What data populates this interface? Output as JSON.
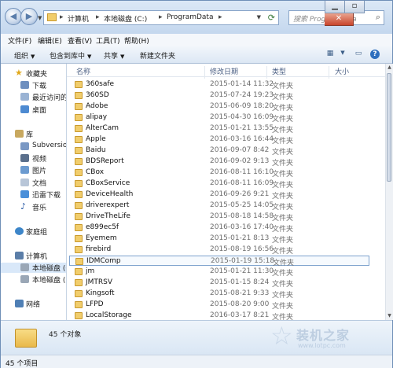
{
  "address": {
    "crumbs": [
      "计算机",
      "本地磁盘 (C:)",
      "ProgramData"
    ],
    "separator": "▸"
  },
  "search": {
    "placeholder": "搜索 ProgramData"
  },
  "menu": [
    "文件(F)",
    "编辑(E)",
    "查看(V)",
    "工具(T)",
    "帮助(H)"
  ],
  "toolbar": {
    "organize": "组织",
    "include": "包含到库中",
    "share": "共享",
    "new_folder": "新建文件夹"
  },
  "nav": {
    "favorites": "收藏夹",
    "downloads": "下载",
    "recent": "最近访问的",
    "desktop": "桌面",
    "library": "库",
    "subversion": "Subversion",
    "videos": "视频",
    "pictures": "图片",
    "docs": "文档",
    "xunlei": "迅雷下载",
    "music": "音乐",
    "homegroup": "家庭组",
    "computer": "计算机",
    "disk_c": "本地磁盘 (C",
    "disk_d": "本地磁盘 (",
    "network": "网络"
  },
  "columns": {
    "name": "名称",
    "date": "修改日期",
    "type": "类型",
    "size": "大小"
  },
  "files": [
    {
      "name": "360safe",
      "date": "2015-01-14 11:32",
      "type": "文件夹"
    },
    {
      "name": "360SD",
      "date": "2015-07-24 19:23",
      "type": "文件夹"
    },
    {
      "name": "Adobe",
      "date": "2015-06-09 18:20",
      "type": "文件夹"
    },
    {
      "name": "alipay",
      "date": "2015-04-30 16:09",
      "type": "文件夹"
    },
    {
      "name": "AlterCam",
      "date": "2015-01-21 13:55",
      "type": "文件夹"
    },
    {
      "name": "Apple",
      "date": "2016-03-16 16:44",
      "type": "文件夹"
    },
    {
      "name": "Baidu",
      "date": "2016-09-07 8:42",
      "type": "文件夹"
    },
    {
      "name": "BDSReport",
      "date": "2016-09-02 9:13",
      "type": "文件夹"
    },
    {
      "name": "CBox",
      "date": "2016-08-11 16:10",
      "type": "文件夹"
    },
    {
      "name": "CBoxService",
      "date": "2016-08-11 16:09",
      "type": "文件夹"
    },
    {
      "name": "DeviceHealth",
      "date": "2016-09-26 9:21",
      "type": "文件夹"
    },
    {
      "name": "driverexpert",
      "date": "2015-05-25 14:05",
      "type": "文件夹"
    },
    {
      "name": "DriveTheLife",
      "date": "2015-08-18 14:58",
      "type": "文件夹"
    },
    {
      "name": "e899ec5f",
      "date": "2016-03-16 17:40",
      "type": "文件夹"
    },
    {
      "name": "Eyemem",
      "date": "2015-01-21 8:13",
      "type": "文件夹"
    },
    {
      "name": "firebird",
      "date": "2015-08-19 16:56",
      "type": "文件夹"
    },
    {
      "name": "IDMComp",
      "date": "2015-01-19 15:18",
      "type": "文件夹",
      "selected": true
    },
    {
      "name": "jm",
      "date": "2015-01-21 11:30",
      "type": "文件夹"
    },
    {
      "name": "JMTRSV",
      "date": "2015-01-15 8:24",
      "type": "文件夹"
    },
    {
      "name": "Kingsoft",
      "date": "2015-08-21 9:33",
      "type": "文件夹"
    },
    {
      "name": "LFPD",
      "date": "2015-08-20 9:00",
      "type": "文件夹"
    },
    {
      "name": "LocalStorage",
      "date": "2016-03-17 8:21",
      "type": "文件夹"
    }
  ],
  "details": {
    "count": "45 个对象"
  },
  "status": {
    "items": "45 个项目"
  },
  "watermark": {
    "brand": "装机之家",
    "url": "www.lotpc.com"
  }
}
